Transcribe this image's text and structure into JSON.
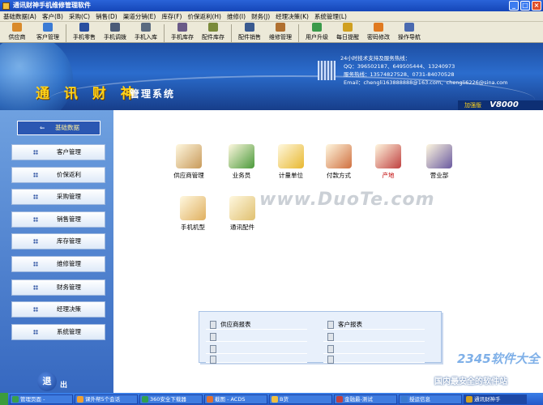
{
  "window": {
    "title": "通讯财神手机维修管理软件",
    "controls": [
      "_",
      "□",
      "×"
    ]
  },
  "menu": [
    "基础数据(A)",
    "客户(B)",
    "采购(C)",
    "销售(D)",
    "渠道分销(E)",
    "库存(F)",
    "价保返利(H)",
    "维修(I)",
    "财务(J)",
    "经理决策(K)",
    "系统管理(L)"
  ],
  "toolbar": [
    {
      "label": "供应商",
      "color": "#d98a2b"
    },
    {
      "label": "客户管理",
      "color": "#3a7bd5"
    },
    {
      "label": "手机零售",
      "color": "#2a4fa0"
    },
    {
      "label": "手机调拨",
      "color": "#4a5a78"
    },
    {
      "label": "手机入库",
      "color": "#5a6a80"
    },
    {
      "label": "手机库存",
      "color": "#6a5a88"
    },
    {
      "label": "配件库存",
      "color": "#7a8a3a"
    },
    {
      "label": "配件销售",
      "color": "#3a5a90"
    },
    {
      "label": "维修管理",
      "color": "#b07030"
    },
    {
      "label": "用户升级",
      "color": "#3a9a4a"
    },
    {
      "label": "每日提醒",
      "color": "#d0a020"
    },
    {
      "label": "密码修改",
      "color": "#e07a20"
    },
    {
      "label": "操作导航",
      "color": "#4a6ab0"
    }
  ],
  "banner": {
    "title": "通 讯 财 神",
    "subtitle": "管理系统",
    "support_heading": "24小时技术支持及服务热线：",
    "qq": "QQ：396502187、649505444、13240973",
    "hotline": "服务热线：13574827528、0731-84070528",
    "email": "Email：chengli163888888@163.com、chengli6226@sina.com",
    "edition": "加强版",
    "version": "V8000"
  },
  "nav": {
    "header": "基础数据",
    "items": [
      "客户管理",
      "价保返利",
      "采购管理",
      "销售管理",
      "库存管理",
      "维修管理",
      "财务管理",
      "经理决策",
      "系统管理"
    ],
    "exit_icon": "退",
    "exit_label": "出"
  },
  "functions": [
    {
      "label": "供应商管理",
      "color": "#c89a5a"
    },
    {
      "label": "业务员",
      "color": "#4a9a3a"
    },
    {
      "label": "计量单位",
      "color": "#e8b830"
    },
    {
      "label": "付款方式",
      "color": "#d07040"
    },
    {
      "label": "产地",
      "color": "#c04040",
      "highlight": true
    },
    {
      "label": "营业部",
      "color": "#6a5aa0"
    },
    {
      "label": "手机机型",
      "color": "#e0b060"
    },
    {
      "label": "通讯配件",
      "color": "#e0c070"
    }
  ],
  "reports": {
    "left": [
      "供应商报表",
      "",
      "",
      ""
    ],
    "right": [
      "客户报表",
      "",
      "",
      ""
    ]
  },
  "watermark": "www.DuoTe.com",
  "brand": {
    "name": "2345软件大全",
    "slogan": "国内最安全的软件站"
  },
  "taskbar": [
    {
      "label": "管理页面 -",
      "color": "#3aa04a"
    },
    {
      "label": "课外帮5个会话",
      "color": "#f0a030"
    },
    {
      "label": "360安全下载器",
      "color": "#30a050"
    },
    {
      "label": "截图 - ACDS",
      "color": "#e07030"
    },
    {
      "label": "B货",
      "color": "#f0c040"
    },
    {
      "label": "金融最-测试",
      "color": "#c04040"
    },
    {
      "label": "授运信息",
      "color": "#3a7ad0"
    },
    {
      "label": "通讯财神手",
      "color": "#d0a020"
    }
  ]
}
